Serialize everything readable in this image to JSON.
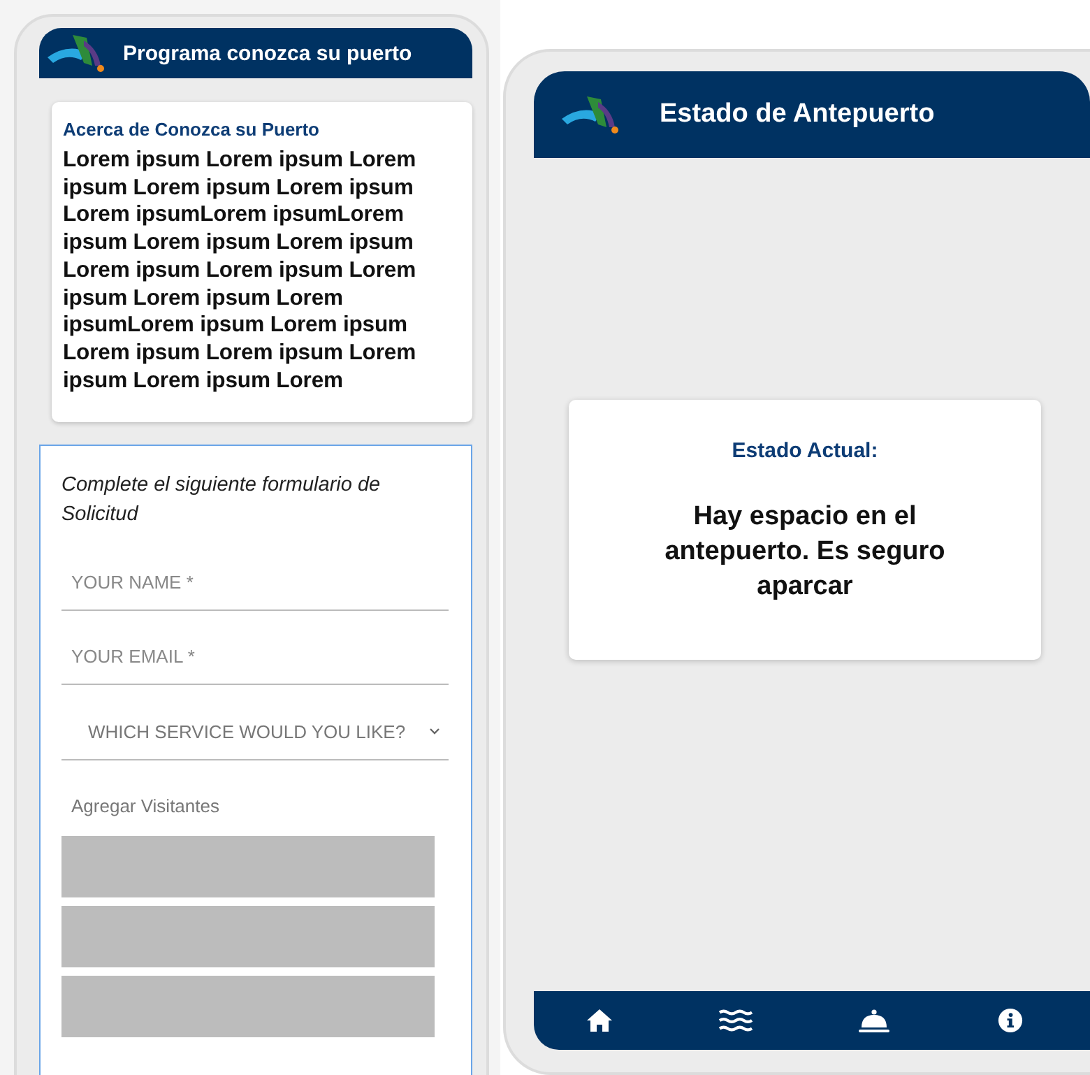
{
  "left_screen": {
    "header": {
      "title": "Programa conozca su puerto"
    },
    "about": {
      "title": "Acerca de Conozca su Puerto",
      "body": "Lorem ipsum Lorem ipsum Lorem ipsum Lorem ipsum Lorem ipsum Lorem ipsumLorem ipsumLorem ipsum Lorem ipsum Lorem ipsum Lorem ipsum Lorem ipsum Lorem ipsum Lorem ipsum Lorem ipsumLorem ipsum Lorem ipsum Lorem ipsum Lorem ipsum Lorem ipsum Lorem ipsum Lorem"
    },
    "form": {
      "intro": "Complete el siguiente formulario de Solicitud",
      "fields": [
        {
          "kind": "text",
          "placeholder": "YOUR NAME *"
        },
        {
          "kind": "text",
          "placeholder": "YOUR EMAIL *"
        },
        {
          "kind": "select",
          "placeholder": "WHICH SERVICE WOULD YOU LIKE?"
        }
      ],
      "visitors_label": "Agregar Visitantes",
      "visitors": [
        {
          "kind": "blank"
        },
        {
          "kind": "blank"
        },
        {
          "kind": "blank"
        }
      ]
    }
  },
  "right_screen": {
    "header": {
      "title": "Estado de Antepuerto"
    },
    "status": {
      "label": "Estado Actual:",
      "message": "Hay espacio en el antepuerto. Es seguro aparcar"
    },
    "nav": [
      {
        "kind": "home"
      },
      {
        "kind": "waves"
      },
      {
        "kind": "bell"
      },
      {
        "kind": "info"
      }
    ]
  }
}
